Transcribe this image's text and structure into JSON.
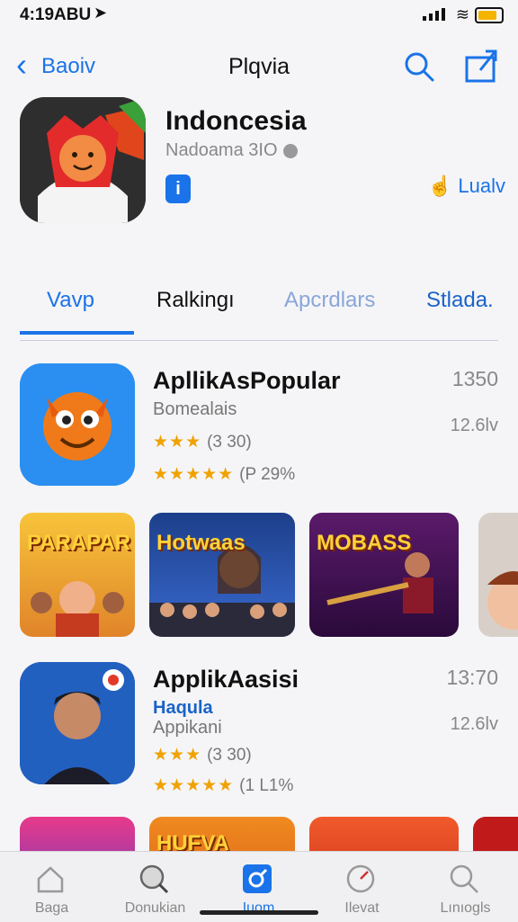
{
  "status": {
    "time": "4:19ABU"
  },
  "nav": {
    "back_label": "Baoiv",
    "title": "Plqvia"
  },
  "app": {
    "name": "Indoncesia",
    "subtitle": "Nadoama 3IO",
    "age_badge": "i",
    "like_label": "Lualv"
  },
  "tabs": [
    {
      "label": "Vavp"
    },
    {
      "label": "Ralkingı"
    },
    {
      "label": "Apcrdlars"
    },
    {
      "label": "Stlada."
    }
  ],
  "items": [
    {
      "title": "ApllikAsPopular",
      "subtitle": "Bomealais",
      "rating1_stars": "★★★",
      "rating1_text": "(3 30)",
      "rating2_stars": "★★★★★",
      "rating2_text": "(P 29%",
      "num1": "1350",
      "num2": "12.6lv"
    },
    {
      "title": "ApplikAasisi",
      "subtitle": "Haqula",
      "subtitle2": "Appikani",
      "rating1_stars": "★★★",
      "rating1_text": "(3 30)",
      "rating2_stars": "★★★★★",
      "rating2_text": "(1 L1%",
      "num1": "13:70",
      "num2": "12.6lv"
    }
  ],
  "strip1": [
    {
      "caption": "PARAPAR"
    },
    {
      "caption": "Hotwaas"
    },
    {
      "caption": "MOBASS"
    },
    {
      "caption": ""
    }
  ],
  "strip2": [
    {
      "caption": ""
    },
    {
      "caption": "HUFVA"
    },
    {
      "caption": ""
    },
    {
      "caption": ""
    }
  ],
  "tabbar": [
    {
      "label": "Baga",
      "icon": "home-icon"
    },
    {
      "label": "Donukian",
      "icon": "discover-icon"
    },
    {
      "label": "Iuom",
      "icon": "apps-icon"
    },
    {
      "label": "Ilevat",
      "icon": "gauge-icon"
    },
    {
      "label": "Lınıogls",
      "icon": "search-icon"
    }
  ],
  "colors": {
    "accent": "#1a73e8",
    "stars": "#f0a200"
  }
}
